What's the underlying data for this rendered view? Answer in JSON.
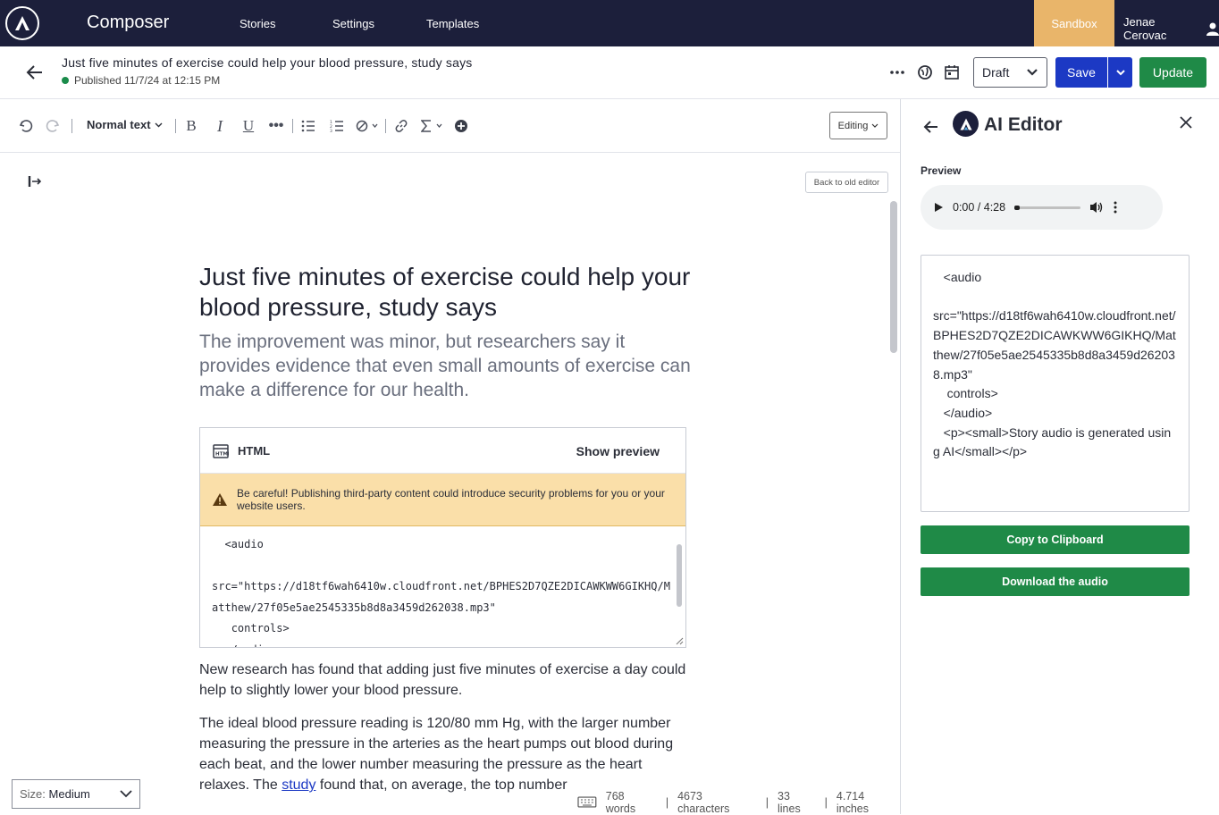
{
  "topnav": {
    "app_title": "Composer",
    "links": [
      "Stories",
      "Settings",
      "Templates"
    ],
    "sandbox": "Sandbox",
    "user": "Jenae Cerovac"
  },
  "story": {
    "title": "Just five minutes of exercise could help your blood pressure, study says",
    "status": "Published 11/7/24 at 12:15 PM",
    "status_color": "#1a8b4a",
    "draft_label": "Draft",
    "save_label": "Save",
    "update_label": "Update"
  },
  "toolbar": {
    "text_style": "Normal text",
    "mode": "Editing"
  },
  "editor": {
    "back_old": "Back to old editor",
    "headline": "Just five minutes of exercise could help your blood pressure, study says",
    "subhead": "The improvement was minor, but researchers say it provides evidence that even small amounts of exercise can make a difference for our health.",
    "html_block": {
      "label": "HTML",
      "show_preview": "Show preview",
      "warning": "Be careful! Publishing third-party content could introduce security problems for you or your website users.",
      "code": "  <audio\n\nsrc=\"https://d18tf6wah6410w.cloudfront.net/BPHES2D7QZE2DICAWKWW6GIKHQ/Matthew/27f05e5ae2545335b8d8a3459d262038.mp3\"\n   controls>\n  </audio>"
    },
    "paragraph1": "New research has found that adding just five minutes of exercise a day could help to slightly lower your blood pressure.",
    "paragraph2_before": "The ideal blood pressure reading is 120/80 mm Hg, with the larger number measuring the pressure in the arteries as the heart pumps out blood during each beat, and the lower number measuring the pressure as the heart relaxes. The ",
    "paragraph2_link": "study",
    "paragraph2_after": " found that, on average, the top number",
    "size_label": "Size:",
    "size_value": "Medium",
    "stats": {
      "words": "768 words",
      "characters": "4673 characters",
      "lines": "33 lines",
      "inches": "4.714 inches"
    }
  },
  "ai_panel": {
    "title": "AI Editor",
    "preview_label": "Preview",
    "audio_time": "0:00 / 4:28",
    "audio_progress": 0.0,
    "code": "   <audio\n\nsrc=\"https://d18tf6wah6410w.cloudfront.net/BPHES2D7QZE2DICAWKWW6GIKHQ/Matthew/27f05e5ae2545335b8d8a3459d262038.mp3\"\n    controls>\n   </audio>\n   <p><small>Story audio is generated using AI</small></p>",
    "copy_label": "Copy to Clipboard",
    "download_label": "Download the audio"
  },
  "colors": {
    "nav_bg": "#1c1f3b",
    "sandbox": "#e9b56a",
    "save": "#1c39c4",
    "update": "#1f8a47",
    "warning_bg": "#fadfa9"
  }
}
